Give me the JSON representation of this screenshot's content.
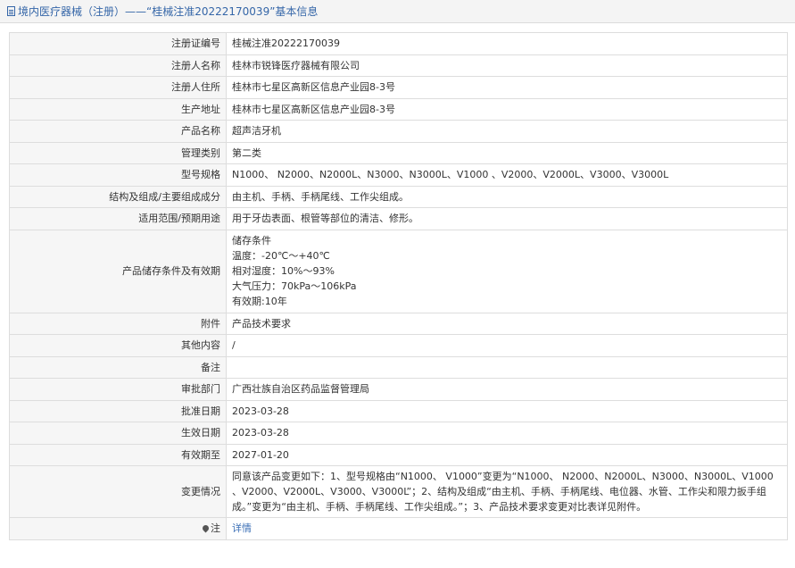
{
  "header": {
    "title": "境内医疗器械（注册）——“桂械注准20222170039”基本信息"
  },
  "rows": [
    {
      "label": "注册证编号",
      "value": "桂械注准20222170039"
    },
    {
      "label": "注册人名称",
      "value": "桂林市锐锋医疗器械有限公司"
    },
    {
      "label": "注册人住所",
      "value": "桂林市七星区高新区信息产业园8-3号"
    },
    {
      "label": "生产地址",
      "value": "桂林市七星区高新区信息产业园8-3号"
    },
    {
      "label": "产品名称",
      "value": "超声洁牙机"
    },
    {
      "label": "管理类别",
      "value": "第二类"
    },
    {
      "label": "型号规格",
      "value": "N1000、 N2000、N2000L、N3000、N3000L、V1000 、V2000、V2000L、V3000、V3000L"
    },
    {
      "label": "结构及组成/主要组成成分",
      "value": "由主机、手柄、手柄尾线、工作尖组成。"
    },
    {
      "label": "适用范围/预期用途",
      "value": "用于牙齿表面、根管等部位的清洁、修形。"
    }
  ],
  "storage": {
    "label": "产品储存条件及有效期",
    "lines": [
      "储存条件",
      "温度：-20℃～+40℃",
      "相对湿度：10%～93%",
      "大气压力：70kPa～106kPa",
      "有效期:10年"
    ]
  },
  "rows2": [
    {
      "label": "附件",
      "value": "产品技术要求"
    },
    {
      "label": "其他内容",
      "value": "/"
    },
    {
      "label": "备注",
      "value": ""
    },
    {
      "label": "审批部门",
      "value": "广西壮族自治区药品监督管理局"
    },
    {
      "label": "批准日期",
      "value": "2023-03-28"
    },
    {
      "label": "生效日期",
      "value": "2023-03-28"
    },
    {
      "label": "有效期至",
      "value": "2027-01-20"
    }
  ],
  "change": {
    "label": "变更情况",
    "value": "同意该产品变更如下：1、型号规格由“N1000、 V1000”变更为“N1000、 N2000、N2000L、N3000、N3000L、V1000 、V2000、V2000L、V3000、V3000L”；2、结构及组成“由主机、手柄、手柄尾线、电位器、水管、工作尖和限力扳手组成。”变更为“由主机、手柄、手柄尾线、工作尖组成。”；3、产品技术要求变更对比表详见附件。"
  },
  "note": {
    "icon": "pin-icon",
    "label": "注",
    "link_text": "详情"
  }
}
